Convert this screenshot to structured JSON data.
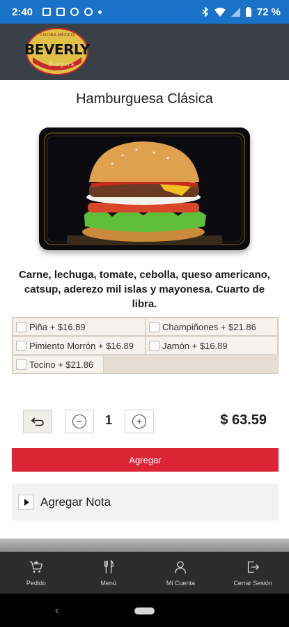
{
  "status_bar": {
    "time": "2:40",
    "battery": "72 %",
    "icons": [
      "image-icon",
      "news-icon",
      "whatsapp-icon",
      "whatsapp-icon",
      "dot-icon",
      "bluetooth-icon",
      "wifi-icon",
      "signal-icon",
      "battery-icon"
    ]
  },
  "header": {
    "logo_alt": "Beverly Burgers",
    "logo_text": "BEVERLY",
    "logo_subtext": "Burgers",
    "logo_top_text": "COCINA MÉXICO"
  },
  "product": {
    "title": "Hamburguesa Clásica",
    "description": "Carne, lechuga, tomate, cebolla, queso americano, catsup, aderezo mil islas y mayonesa. Cuarto de libra.",
    "image_alt": "hamburger-photo"
  },
  "extras": [
    {
      "label": "Piña + $16.89",
      "checked": false
    },
    {
      "label": "Champiñones + $21.86",
      "checked": false
    },
    {
      "label": "Pimiento Morrón + $16.89",
      "checked": false
    },
    {
      "label": "Jamón + $16.89",
      "checked": false
    },
    {
      "label": "Tocino + $21.86",
      "checked": false
    }
  ],
  "quantity": {
    "value": "1",
    "minus_icon": "minus-circle-icon",
    "plus_icon": "plus-circle-icon",
    "back_icon": "undo-icon"
  },
  "price": "$ 63.59",
  "add_button_label": "Agregar",
  "note": {
    "label": "Agregar Nota"
  },
  "bottom_nav": [
    {
      "label": "Pedido",
      "icon": "cart-icon"
    },
    {
      "label": "Menú",
      "icon": "utensils-icon"
    },
    {
      "label": "Mi Cuenta",
      "icon": "user-icon"
    },
    {
      "label": "Cerrar Sesión",
      "icon": "logout-icon"
    }
  ],
  "colors": {
    "status_bar": "#1a73c8",
    "header": "#3a4048",
    "add_button": "#dc2536",
    "bottom_nav": "#2c2c2c"
  }
}
